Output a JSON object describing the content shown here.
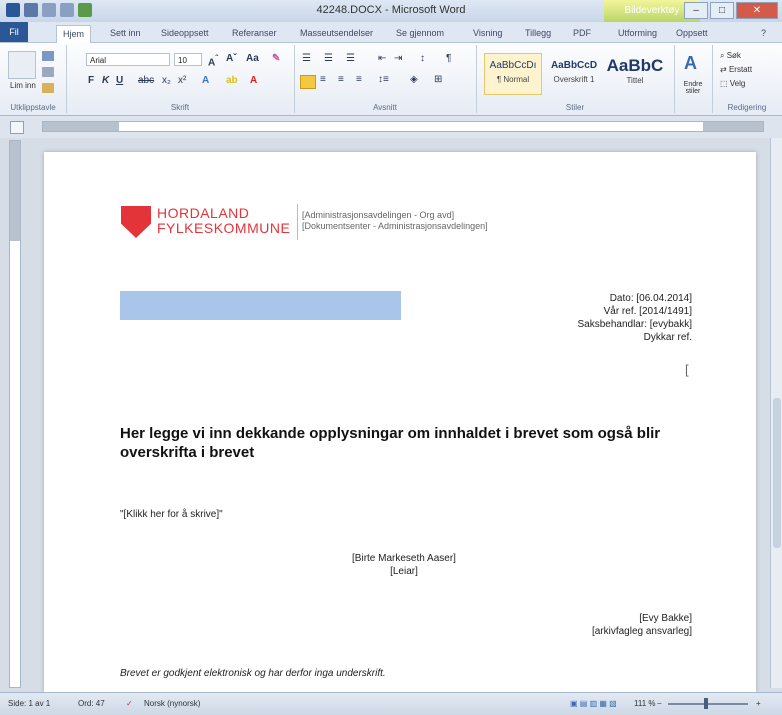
{
  "window": {
    "title": "42248.DOCX - Microsoft Word",
    "context_tab": "Bildeverktøy"
  },
  "tabs": [
    "Fil",
    "Hjem",
    "Sett inn",
    "Sideoppsett",
    "Referanser",
    "Masseutsendelser",
    "Se gjennom",
    "Visning",
    "Tillegg",
    "PDF",
    "Utforming",
    "Oppsett"
  ],
  "ribbon": {
    "font_name": "Arial",
    "font_size": "10",
    "groups": [
      "Utklippstavle",
      "Skrift",
      "Avsnitt",
      "Stiler",
      "Redigering"
    ],
    "paste_label": "Lim inn",
    "styles": [
      {
        "sample": "AaBbCcDı",
        "name": "¶ Normal"
      },
      {
        "sample": "AaBbCcD",
        "name": "Overskrift 1"
      },
      {
        "sample": "AaBbC",
        "name": "Tittel"
      }
    ],
    "change_styles": "Endre stiler",
    "find": "Søk",
    "replace": "Erstatt",
    "select": "Velg"
  },
  "document": {
    "logo_line1": "HORDALAND",
    "logo_line2": "FYLKESKOMMUNE",
    "dept_line1": "[Administrasjonsavdelingen - Org avd]",
    "dept_line2": "[Dokumentsenter - Administrasjonsavdelingen]",
    "meta": [
      "Dato: [06.04.2014]",
      "Vår ref. [2014/1491]",
      "Saksbehandlar: [evybakk]",
      "Dykkar ref."
    ],
    "heading": "Her legge vi inn dekkande opplysningar om innhaldet i brevet som også blir overskrifta i brevet",
    "body": "\"[Klikk her for å skrive]\"",
    "signer1": "[Birte Markeseth Aaser]",
    "signer1_title": "[Leiar]",
    "signer2": "[Evy Bakke]",
    "signer2_title": "[arkivfagleg ansvarleg]",
    "footnote": "Brevet er godkjent elektronisk og har derfor inga underskrift."
  },
  "status": {
    "page": "Side: 1 av 1",
    "words": "Ord: 47",
    "language": "Norsk (nynorsk)",
    "zoom": "111 %"
  },
  "colors": {
    "brand_red": "#e3343a",
    "placeholder_blue": "#a9c6ea",
    "file_tab": "#2b5797"
  }
}
